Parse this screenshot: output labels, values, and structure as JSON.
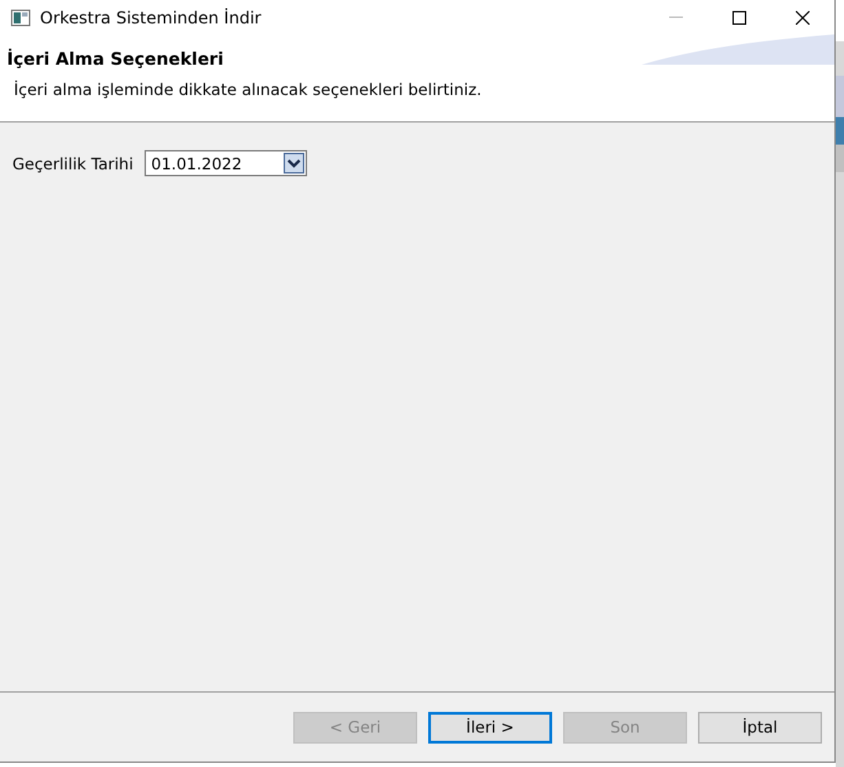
{
  "window": {
    "title": "Orkestra Sisteminden İndir"
  },
  "header": {
    "title": "İçeri Alma Seçenekleri",
    "description": "İçeri alma işleminde dikkate alınacak seçenekleri belirtiniz."
  },
  "fields": [
    {
      "label": "Geçerlilik Tarihi",
      "value": "01.01.2022"
    }
  ],
  "buttons": [
    {
      "label": "< Geri",
      "disabled": true,
      "focused": false
    },
    {
      "label": "İleri >",
      "disabled": false,
      "focused": true
    },
    {
      "label": "Son",
      "disabled": true,
      "focused": false
    },
    {
      "label": "İptal",
      "disabled": false,
      "focused": false
    }
  ]
}
